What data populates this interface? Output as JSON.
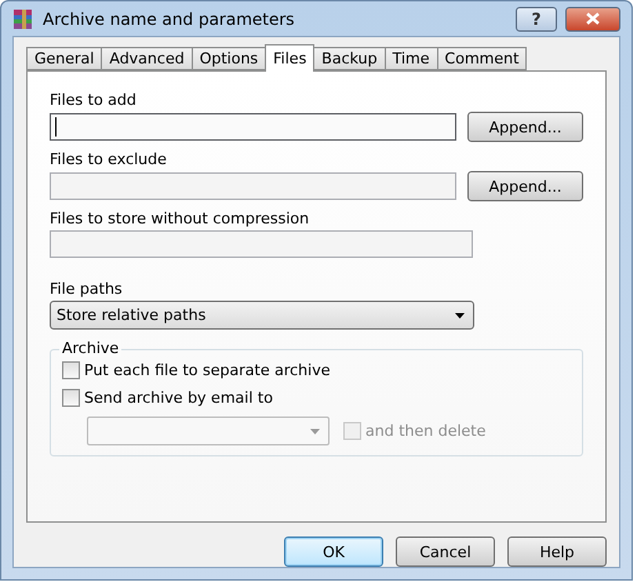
{
  "window": {
    "title": "Archive name and parameters",
    "help_button": "?"
  },
  "tabs": [
    {
      "label": "General",
      "selected": false
    },
    {
      "label": "Advanced",
      "selected": false
    },
    {
      "label": "Options",
      "selected": false
    },
    {
      "label": "Files",
      "selected": true
    },
    {
      "label": "Backup",
      "selected": false
    },
    {
      "label": "Time",
      "selected": false
    },
    {
      "label": "Comment",
      "selected": false
    }
  ],
  "fields": [
    {
      "label": "Files to add",
      "focused": true,
      "button": "Append..."
    },
    {
      "label": "Files to exclude",
      "focused": false,
      "button": "Append..."
    },
    {
      "label": "Files to store without compression",
      "focused": false
    }
  ],
  "file_paths": {
    "label": "File paths",
    "value": "Store relative paths"
  },
  "archive_group": {
    "title": "Archive",
    "options": [
      {
        "label": "Put each file to separate archive",
        "checked": false
      },
      {
        "label": "Send archive by email to",
        "checked": false
      }
    ],
    "then_delete": {
      "label": "and then delete",
      "checked": false,
      "disabled": true
    }
  },
  "buttons": [
    {
      "label": "OK",
      "default": true
    },
    {
      "label": "Cancel",
      "default": false
    },
    {
      "label": "Help",
      "default": false
    }
  ]
}
